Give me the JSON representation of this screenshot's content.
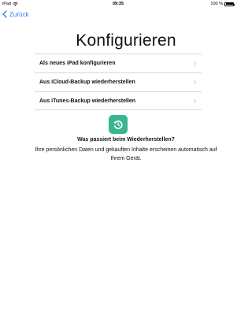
{
  "status_bar": {
    "device": "iPad",
    "time": "09:35",
    "battery": "100 %",
    "battery_level": 1.0,
    "icons": [
      "wifi-icon",
      "battery-icon"
    ]
  },
  "nav": {
    "back_label": "Zurück",
    "back_icon": "chevron-left-icon"
  },
  "page": {
    "title": "Konfigurieren"
  },
  "options": [
    {
      "label": "Als neues iPad konfigurieren"
    },
    {
      "label": "Aus iCloud-Backup wiederherstellen"
    },
    {
      "label": "Aus iTunes-Backup wiederherstellen"
    }
  ],
  "info": {
    "icon": "restore-icon",
    "heading": "Was passiert beim Wiederherstellen?",
    "text": "Ihre persönlichen Daten und gekauften Inhalte erscheinen automatisch auf Ihrem Gerät."
  },
  "colors": {
    "accent": "#2f7cf6",
    "restore_icon_bg": "#39b58f",
    "separator": "#d8d8dc"
  }
}
